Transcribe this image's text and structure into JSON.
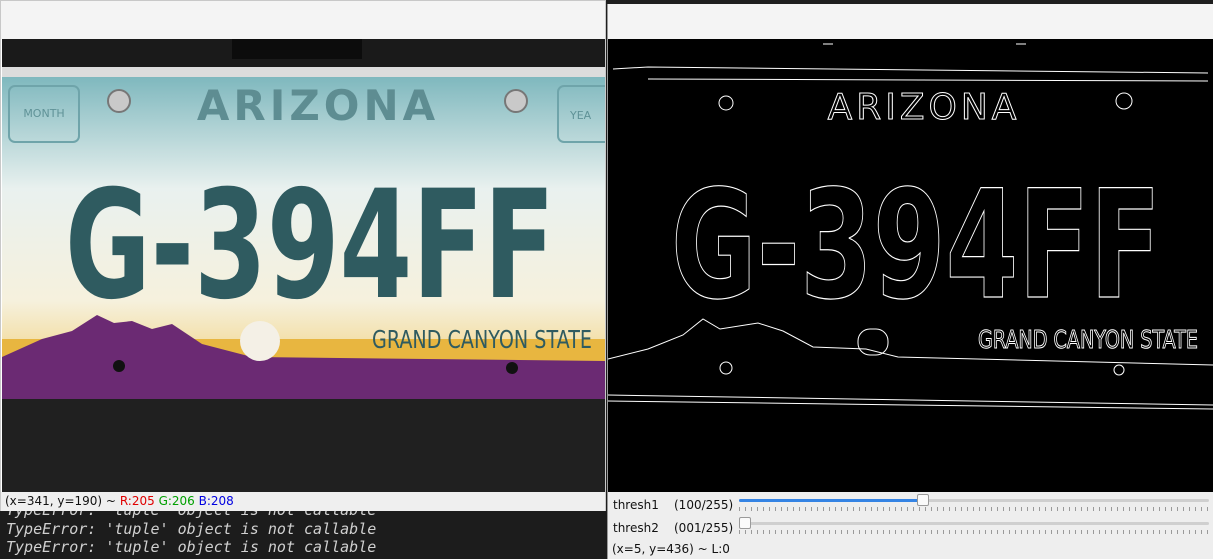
{
  "terminal": {
    "lines": [
      "TypeError: 'tuple' object is not callable",
      "TypeError: 'tuple' object is not callable",
      "TypeError: 'tuple' object is not callable"
    ]
  },
  "left_window": {
    "plate": {
      "state": "ARIZONA",
      "number": "G-394FF",
      "slogan": "GRAND CANYON STATE",
      "month_label": "MONTH",
      "year_label": "YEA"
    },
    "status": {
      "coords": "(x=341, y=190) ~",
      "r": "R:205",
      "g": "G:206",
      "b": "B:208"
    }
  },
  "right_window": {
    "edges": {
      "state": "ARIZONA",
      "number": "G-394FF",
      "slogan": "GRAND CANYON STATE"
    },
    "trackbars": [
      {
        "name": "thresh1",
        "value_text": "(100/255)",
        "value": 100,
        "max": 255
      },
      {
        "name": "thresh2",
        "value_text": "(001/255)",
        "value": 1,
        "max": 255
      }
    ],
    "status": "(x=5, y=436) ~ L:0"
  },
  "colors": {
    "plate_teal": "#2f5b60",
    "plate_purple": "#6b2a73",
    "plate_yellow": "#e8b640",
    "accent_blue": "#3584e4"
  }
}
